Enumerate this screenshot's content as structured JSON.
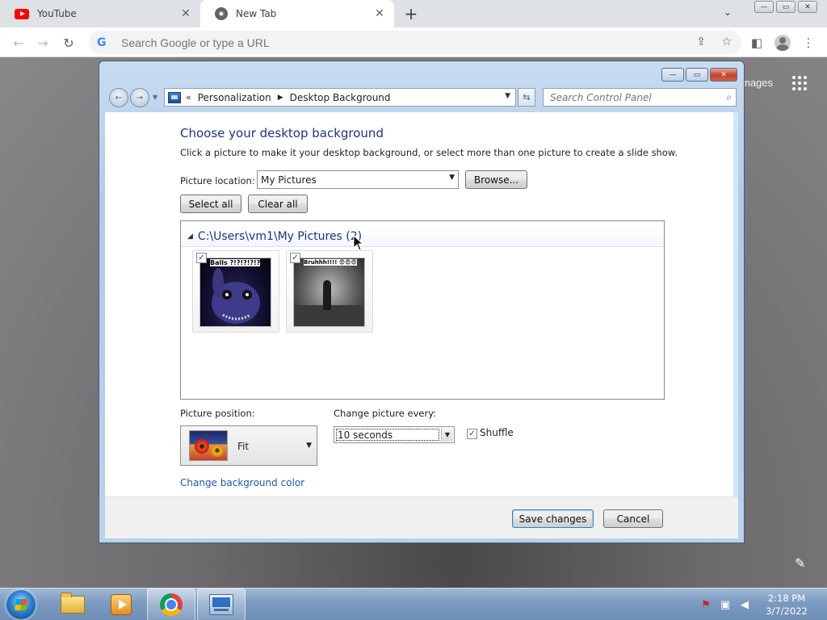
{
  "browser": {
    "tabs": [
      {
        "label": "YouTube",
        "active": false
      },
      {
        "label": "New Tab",
        "active": true
      }
    ],
    "close_glyph": "✕",
    "new_tab_glyph": "+",
    "tab_search_glyph": "⌄",
    "omnibox_placeholder": "Search Google or type a URL",
    "back_glyph": "←",
    "forward_glyph": "→",
    "reload_glyph": "↻",
    "share_glyph": "⇪",
    "star_glyph": "☆",
    "sidepanel_glyph": "◧",
    "menu_glyph": "⋮",
    "google_g": "G"
  },
  "newtab": {
    "images_link": "mages",
    "edit_glyph": "✎"
  },
  "window": {
    "min_glyph": "—",
    "max_glyph": "▭",
    "close_glyph": "✕",
    "back_glyph": "←",
    "fwd_glyph": "→",
    "breadcrumb": {
      "chevron": "«",
      "items": [
        "Personalization",
        "Desktop Background"
      ],
      "separator": "▶"
    },
    "search_placeholder": "Search Control Panel",
    "search_glyph": "⌕",
    "refresh_glyph": "⇆"
  },
  "content": {
    "heading": "Choose your desktop background",
    "description": "Click a picture to make it your desktop background, or select more than one picture to create a slide show.",
    "picture_location_label": "Picture location:",
    "picture_location_value": "My Pictures",
    "browse_label": "Browse...",
    "select_all_label": "Select all",
    "clear_all_label": "Clear all",
    "group_header": "C:\\Users\\vm1\\My Pictures (2)",
    "thumbnails": [
      {
        "caption": "Balls ?!?!?!?!?",
        "checked": true
      },
      {
        "caption": "Bruhhh!!!! 😨😨😨",
        "checked": true
      }
    ],
    "picture_position_label": "Picture position:",
    "picture_position_value": "Fit",
    "change_every_label": "Change picture every:",
    "change_every_value": "10 seconds",
    "shuffle_label": "Shuffle",
    "shuffle_checked": true,
    "change_color_link": "Change background color",
    "save_label": "Save changes",
    "cancel_label": "Cancel"
  },
  "taskbar": {
    "time": "2:18 PM",
    "date": "3/7/2022",
    "apps": [
      "windows-explorer",
      "media-player",
      "google-chrome",
      "control-panel"
    ]
  }
}
